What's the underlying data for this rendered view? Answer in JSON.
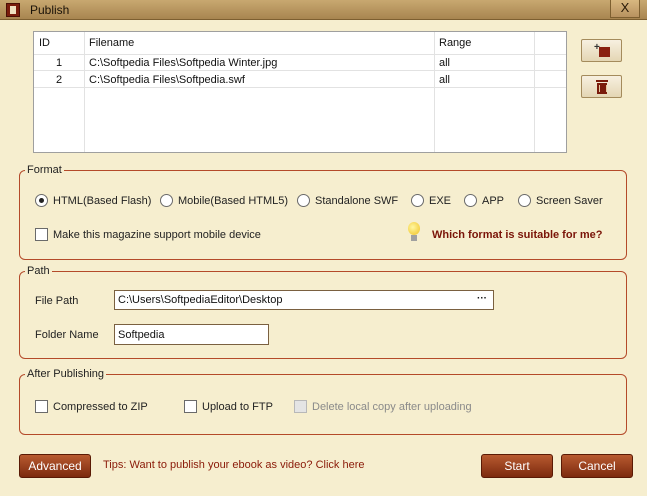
{
  "window": {
    "title": "Publish",
    "close_label": "X"
  },
  "file_table": {
    "headers": [
      "ID",
      "Filename",
      "Range"
    ],
    "rows": [
      {
        "id": "1",
        "filename": "C:\\Softpedia Files\\Softpedia Winter.jpg",
        "range": "all"
      },
      {
        "id": "2",
        "filename": "C:\\Softpedia Files\\Softpedia.swf",
        "range": "all"
      }
    ]
  },
  "format": {
    "title": "Format",
    "options": [
      {
        "label": "HTML(Based Flash)",
        "checked": true
      },
      {
        "label": "Mobile(Based HTML5)",
        "checked": false
      },
      {
        "label": "Standalone SWF",
        "checked": false
      },
      {
        "label": "EXE",
        "checked": false
      },
      {
        "label": "APP",
        "checked": false
      },
      {
        "label": "Screen Saver",
        "checked": false
      }
    ],
    "mobile_support_label": "Make this magazine support mobile device",
    "help_link": "Which format is suitable for me?"
  },
  "path": {
    "title": "Path",
    "file_path_label": "File Path",
    "file_path_value": "C:\\Users\\SoftpediaEditor\\Desktop",
    "browse_label": "···",
    "folder_name_label": "Folder Name",
    "folder_name_value": "Softpedia"
  },
  "after_publishing": {
    "title": "After Publishing",
    "compressed_label": "Compressed to ZIP",
    "ftp_label": "Upload to FTP",
    "delete_label": "Delete local copy after uploading"
  },
  "footer": {
    "advanced_label": "Advanced",
    "tips_text": "Tips: Want to publish your ebook as video? Click here",
    "start_label": "Start",
    "cancel_label": "Cancel"
  },
  "colors": {
    "accent": "#7c2a0e",
    "border": "#b44a2a",
    "link": "#7a1408",
    "background": "#f6eecf"
  }
}
